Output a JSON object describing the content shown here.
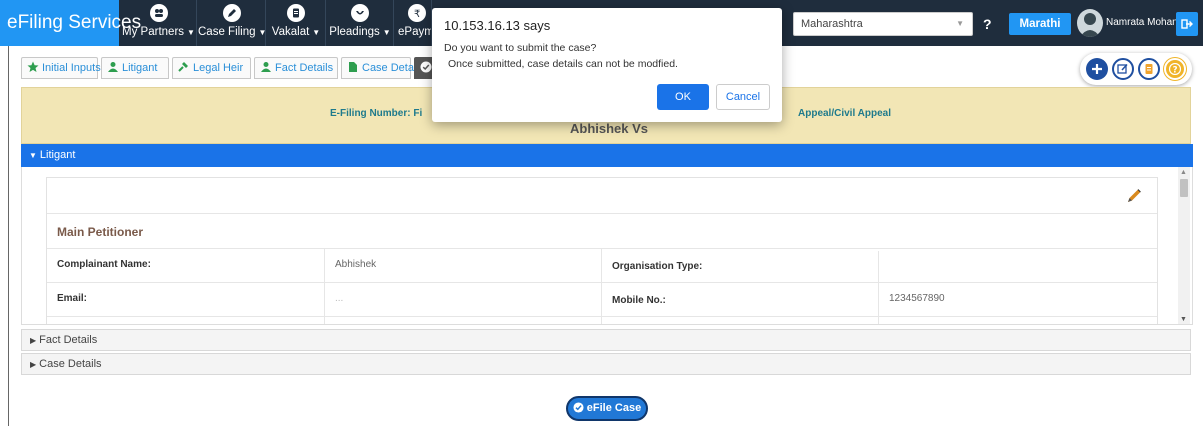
{
  "navbar": {
    "brand": "eFiling Services",
    "items": [
      {
        "label": "My Partners",
        "icon": "partners-icon"
      },
      {
        "label": "Case Filing",
        "icon": "pencil-icon"
      },
      {
        "label": "Vakalat",
        "icon": "document-icon"
      },
      {
        "label": "Pleadings",
        "icon": "pleadings-icon"
      },
      {
        "label": "ePaym",
        "icon": "rupee-icon"
      }
    ],
    "state_selected": "Maharashtra",
    "help_label": "?",
    "language_button": "Marathi",
    "user_name": "Namrata Mohan..."
  },
  "tabs": [
    {
      "label": "Initial Inputs",
      "icon": "star-icon"
    },
    {
      "label": "Litigant",
      "icon": "user-icon"
    },
    {
      "label": "Legal Heir",
      "icon": "gavel-icon"
    },
    {
      "label": "Fact Details",
      "icon": "user-icon"
    },
    {
      "label": "Case Details",
      "icon": "file-icon"
    }
  ],
  "banner": {
    "efiling_number_label": "E-Filing Number: Fi",
    "case_type_fragment": "Appeal/Civil Appeal",
    "parties": "Abhishek Vs"
  },
  "litigant_panel": {
    "header": "Litigant",
    "section_title": "Main Petitioner",
    "rows": [
      {
        "label1": "Complainant Name:",
        "value1": "Abhishek",
        "label2": "Organisation Type:",
        "value2": ""
      },
      {
        "label1": "Email:",
        "value1": "...",
        "label2": "Mobile No.:",
        "value2": "1234567890"
      }
    ]
  },
  "collapsed_panels": [
    "Fact Details",
    "Case Details"
  ],
  "efile_button": "eFile Case",
  "dialog": {
    "title": "10.153.16.13 says",
    "message": "Do you want to submit the case?",
    "submessage": "Once submitted, case details can not be modfied.",
    "ok_label": "OK",
    "cancel_label": "Cancel"
  },
  "colors": {
    "navbar": "#1f2d3d",
    "accent": "#2196f3",
    "panel_header": "#1a73e8",
    "banner": "#f2e6b5",
    "help_icon": "#f0b429"
  }
}
